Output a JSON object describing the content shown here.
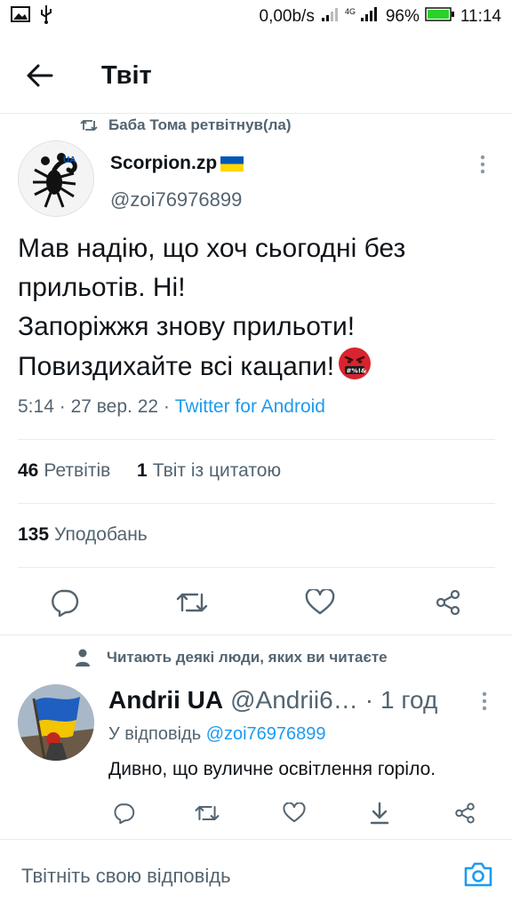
{
  "statusbar": {
    "net_speed": "0,00b/s",
    "battery": "96%",
    "time": "11:14",
    "icons": [
      "image-icon",
      "usb-icon",
      "signal-icon",
      "4g-signal-icon",
      "battery-icon"
    ]
  },
  "header": {
    "title": "Твіт",
    "back_icon": "back-arrow-icon"
  },
  "tweet": {
    "retweeted_by": "Баба Тома ретвітнув(ла)",
    "author": {
      "name": "Scorpion.zp",
      "handle": "@zoi76976899",
      "avatar_badge": "UA"
    },
    "text_lines": [
      "Мав надію, що хоч сьогодні без",
      "прильотів. Ні!",
      "Запоріжжя знову прильоти!",
      "Повиздихайте всі кацапи!"
    ],
    "emoji_text": "#%!&",
    "time": "5:14",
    "date": "27 вер. 22",
    "source": "Twitter for Android",
    "separator": "·",
    "retweets_count": "46",
    "retweets_label": "Ретвітів",
    "quotes_count": "1",
    "quotes_label": "Твіт із цитатою",
    "likes_count": "135",
    "likes_label": "Уподобань"
  },
  "reply": {
    "social_context": "Читають деякі люди, яких ви читаєте",
    "name": "Andrii UA",
    "handle": "@Andrii6…",
    "dot": "·",
    "time": "1 год",
    "replying_prefix": "У відповідь",
    "replying_to": "@zoi76976899",
    "text": "Дивно, що вуличне освітлення горіло."
  },
  "compose": {
    "placeholder": "Твітніть свою відповідь"
  },
  "colors": {
    "accent": "#1d9bf0",
    "secondary_text": "#536471",
    "battery": "#2bd12b",
    "flag_blue": "#0057b7",
    "flag_yellow": "#ffd700"
  }
}
